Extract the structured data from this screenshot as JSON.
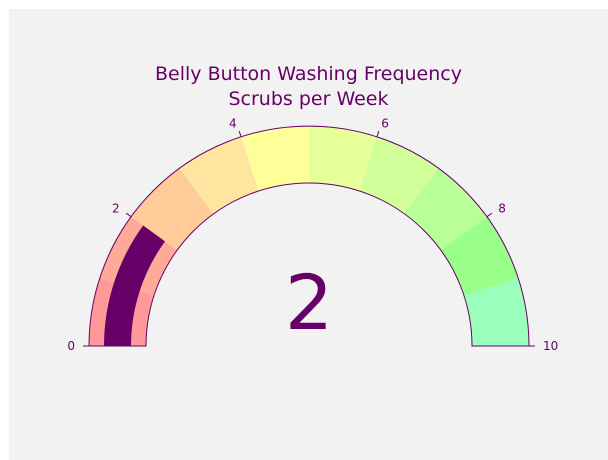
{
  "chart_data": {
    "type": "gauge",
    "title": "Belly Button Washing Frequency",
    "subtitle": "Scrubs per Week",
    "value": 2,
    "range": [
      0,
      10
    ],
    "tick_values": [
      0,
      2,
      4,
      6,
      8,
      10
    ],
    "tick_labels": [
      "0",
      "2",
      "4",
      "6",
      "8",
      "10"
    ],
    "steps": [
      {
        "range": [
          0,
          1
        ],
        "color": "#ff9999"
      },
      {
        "range": [
          1,
          2
        ],
        "color": "#ffaa99"
      },
      {
        "range": [
          2,
          3
        ],
        "color": "#ffcc99"
      },
      {
        "range": [
          3,
          4
        ],
        "color": "#ffe6a0"
      },
      {
        "range": [
          4,
          5
        ],
        "color": "#ffff99"
      },
      {
        "range": [
          5,
          6
        ],
        "color": "#e6ff99"
      },
      {
        "range": [
          6,
          7
        ],
        "color": "#d0ff99"
      },
      {
        "range": [
          7,
          8
        ],
        "color": "#b8ff99"
      },
      {
        "range": [
          8,
          9
        ],
        "color": "#99ff88"
      },
      {
        "range": [
          9,
          10
        ],
        "color": "#99ffbb"
      }
    ],
    "bar_color": "#660066",
    "outline_color": "#660066",
    "background_color": "#f2f2f2",
    "text_color": "#660066"
  }
}
